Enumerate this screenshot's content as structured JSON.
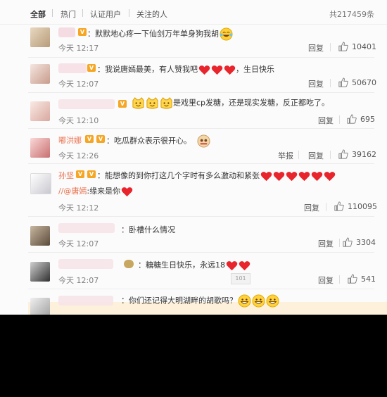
{
  "tabs": [
    {
      "label": "全部",
      "active": true
    },
    {
      "label": "热门",
      "active": false
    },
    {
      "label": "认证用户",
      "active": false
    },
    {
      "label": "关注的人",
      "active": false
    }
  ],
  "total_count": "共217459条",
  "actions": {
    "reply": "回复",
    "report": "举报"
  },
  "comments": [
    {
      "text": "：默默地心疼一下仙剑万年单身狗我胡",
      "time": "今天 12:17",
      "likes": "10401",
      "emoji": [
        "laugh-cry-face-icon"
      ]
    },
    {
      "text": "：我说唐嫣最美，有人赞我吧",
      "text_after": "，生日快乐",
      "time": "今天 12:07",
      "likes": "50670",
      "emoji": [
        "heart-icon",
        "heart-icon",
        "heart-icon"
      ]
    },
    {
      "text": "是戏里cp发糖，还是现实发糖，反正都吃了。",
      "time": "今天 12:10",
      "likes": "695",
      "emoji": [
        "smile-face-icon",
        "smile-face-icon",
        "smile-face-icon"
      ]
    },
    {
      "username": "嘟洪娜",
      "text": "：吃瓜群众表示很开心。",
      "time": "今天 12:26",
      "likes": "39162",
      "emoji": [
        "melon-eater-icon"
      ]
    },
    {
      "username": "孙坚",
      "text": "：能想像的到你打这几个字时有多么激动和紧张",
      "text2_mention": "//@唐嫣",
      "text2": ":缘来是你",
      "time": "今天 12:12",
      "likes": "110095",
      "emoji": [
        "heart-icon",
        "heart-icon",
        "heart-icon",
        "heart-icon",
        "heart-icon",
        "heart-icon"
      ]
    },
    {
      "text": "：卧槽什么情况",
      "time": "今天 12:07",
      "likes": "3304"
    },
    {
      "text": "：糖糖生日快乐，永远18",
      "time": "今天 12:07",
      "likes": "541",
      "emoji": [
        "heart-icon",
        "heart-icon"
      ],
      "sticker_label": "101"
    },
    {
      "text": "：你们还记得大明湖畔的胡歌吗？",
      "emoji": [
        "grin-face-icon",
        "grin-face-icon",
        "grin-face-icon"
      ]
    }
  ],
  "colors": {
    "background": "#fbfbfb",
    "accent": "#eb7350",
    "heart": "#e8242c",
    "vip": "#f6a623"
  }
}
